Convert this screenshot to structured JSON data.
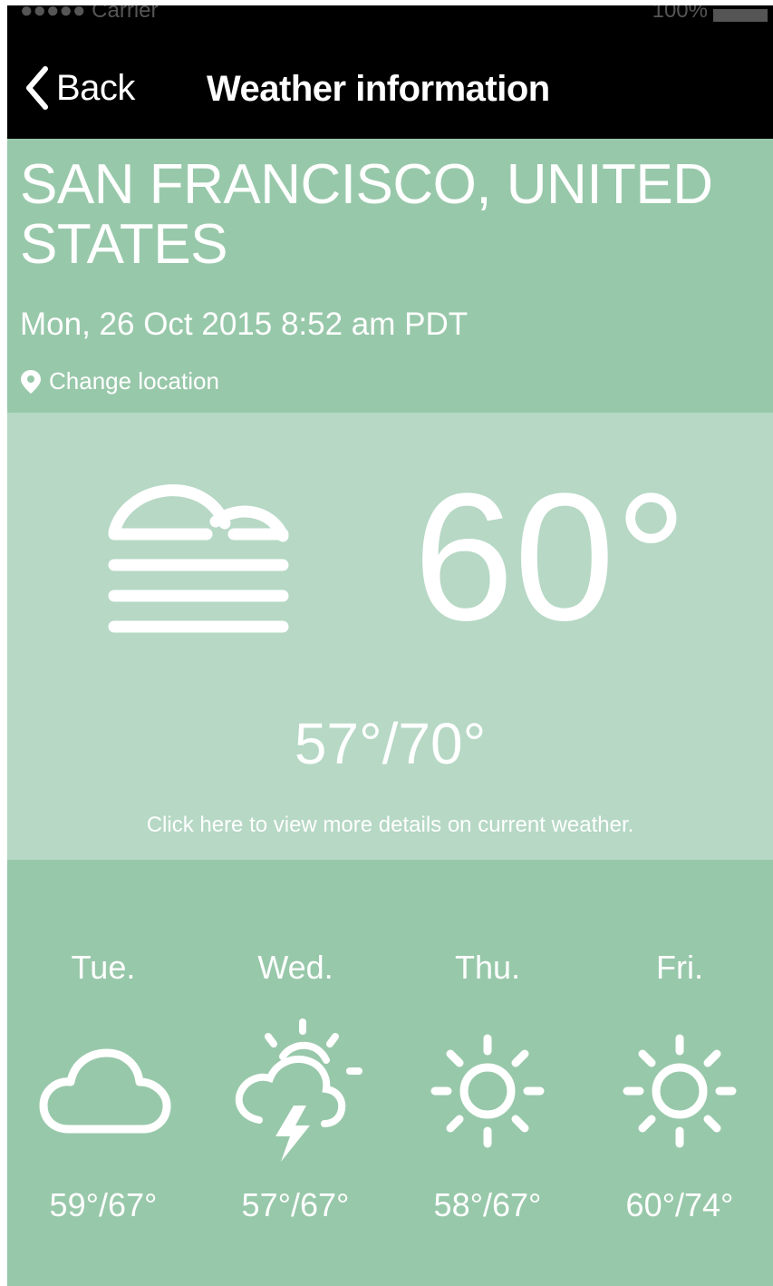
{
  "status_bar": {
    "carrier": "●●●●● Carrier",
    "battery": "100%"
  },
  "nav": {
    "back_label": "Back",
    "title": "Weather information"
  },
  "location": {
    "city": "SAN FRANCISCO, UNITED STATES",
    "datetime": "Mon, 26 Oct 2015 8:52 am PDT",
    "change_label": "Change location",
    "pin_icon": "map-pin-icon"
  },
  "current": {
    "icon": "fog-icon",
    "temperature": "60°",
    "range": "57°/70°",
    "details_link": "Click here to view more details on current weather."
  },
  "forecast": [
    {
      "day": "Tue.",
      "icon": "cloud-icon",
      "range": "59°/67°"
    },
    {
      "day": "Wed.",
      "icon": "thunderstorm-sun-icon",
      "range": "57°/67°"
    },
    {
      "day": "Thu.",
      "icon": "sun-icon",
      "range": "58°/67°"
    },
    {
      "day": "Fri.",
      "icon": "sun-icon",
      "range": "60°/74°"
    }
  ],
  "colors": {
    "header_bg": "#000000",
    "location_bg": "#98c8aa",
    "current_bg": "#b6d8c5",
    "forecast_bg": "#98c8aa",
    "text": "#ffffff"
  }
}
